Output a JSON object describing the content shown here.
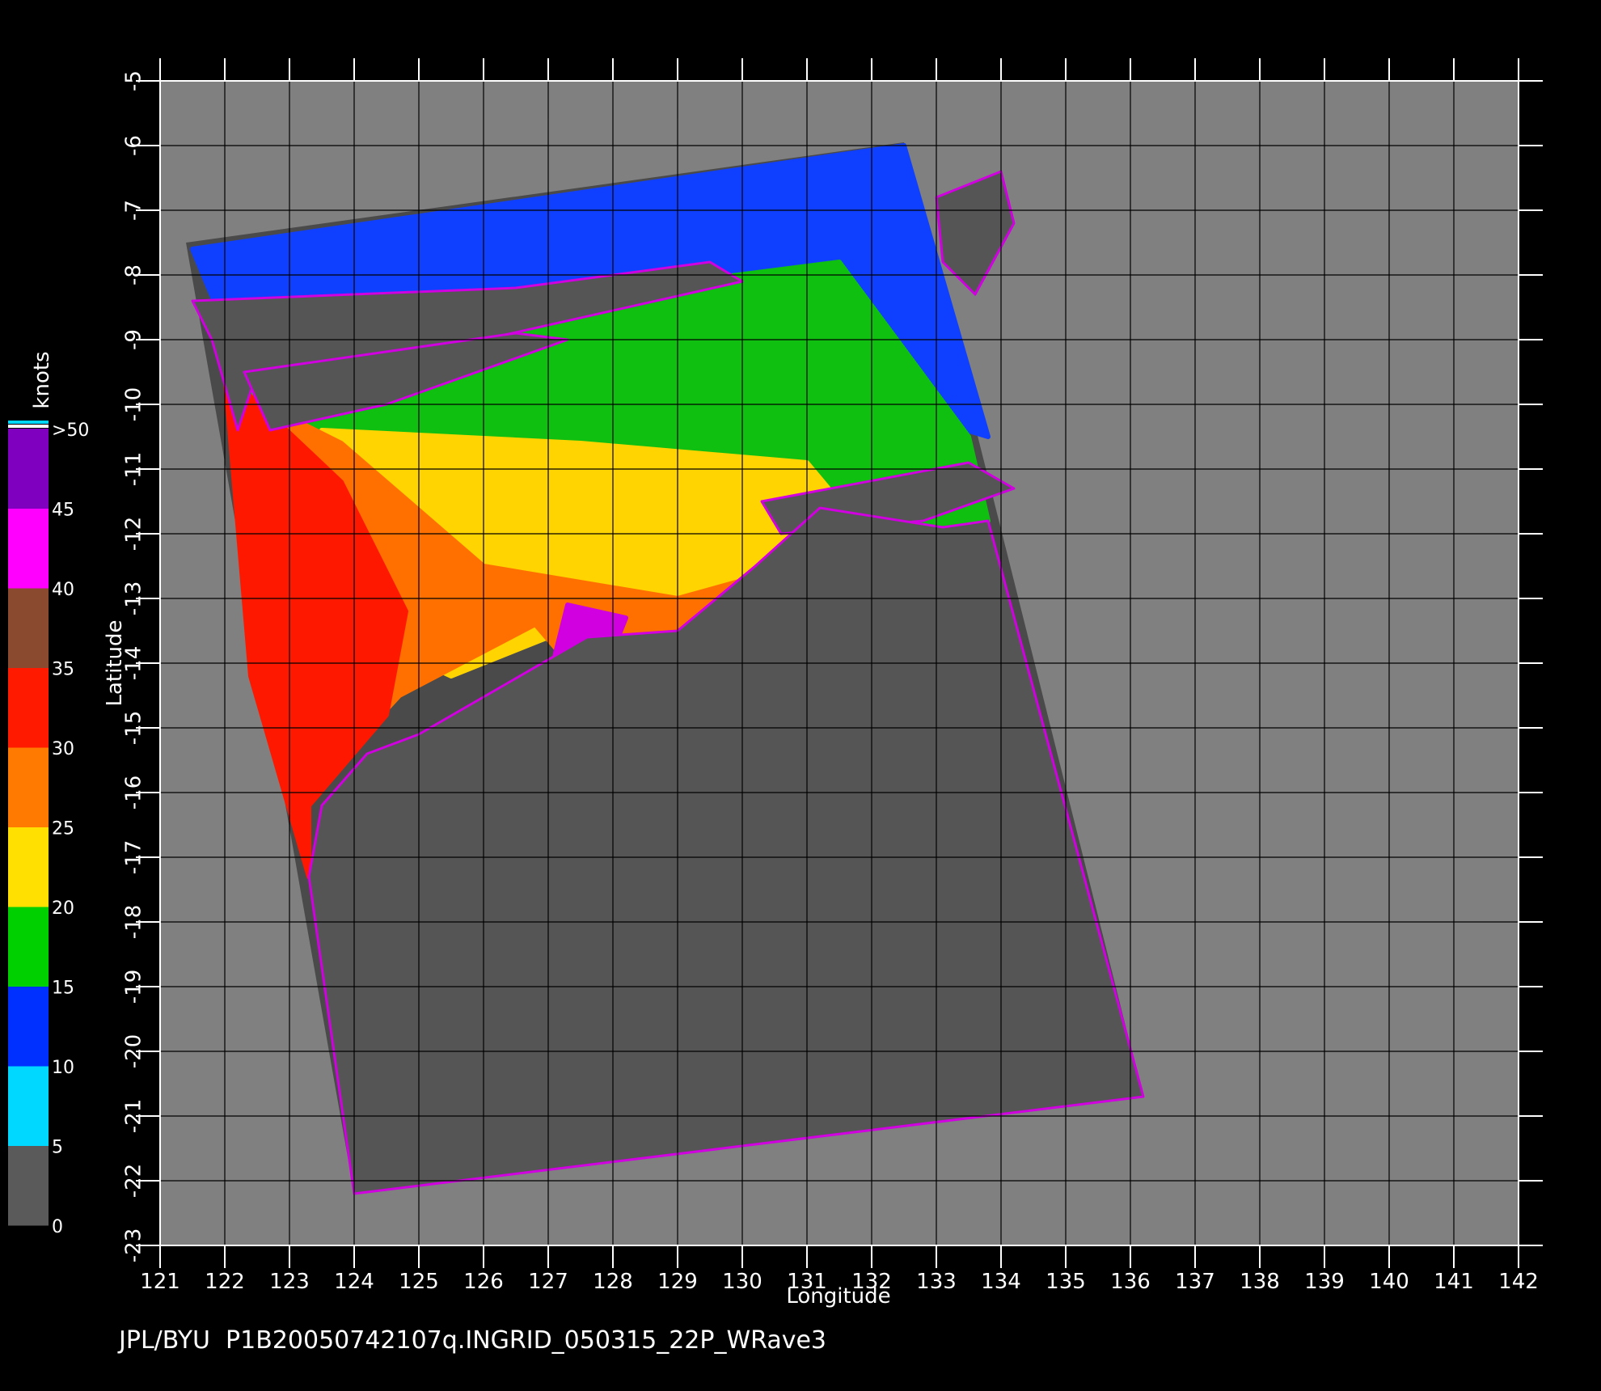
{
  "chart_data": {
    "type": "heatmap",
    "xlabel": "Longitude",
    "ylabel": "Latitude",
    "x_ticks": [
      "121",
      "122",
      "123",
      "124",
      "125",
      "126",
      "127",
      "128",
      "129",
      "130",
      "131",
      "132",
      "133",
      "134",
      "135",
      "136",
      "137",
      "138",
      "139",
      "140",
      "141",
      "142"
    ],
    "y_ticks": [
      "-5",
      "-6",
      "-7",
      "-8",
      "-9",
      "-10",
      "-11",
      "-12",
      "-13",
      "-14",
      "-15",
      "-16",
      "-17",
      "-18",
      "-19",
      "-20",
      "-21",
      "-22",
      "-23"
    ],
    "xlim": [
      121,
      142.3
    ],
    "ylim": [
      -23,
      -5
    ],
    "grid": true,
    "colorbar": {
      "unit_label": "knots",
      "tick_labels": [
        "0",
        "5",
        "10",
        "15",
        "20",
        "25",
        "30",
        "35",
        "40",
        "45",
        ">50"
      ],
      "bands": [
        {
          "from": 0,
          "to": 5,
          "color": "#5a5a5a"
        },
        {
          "from": 5,
          "to": 10,
          "color": "#00d8ff"
        },
        {
          "from": 10,
          "to": 15,
          "color": "#0030ff"
        },
        {
          "from": 15,
          "to": 20,
          "color": "#00d000"
        },
        {
          "from": 20,
          "to": 25,
          "color": "#ffe000"
        },
        {
          "from": 25,
          "to": 30,
          "color": "#ff7a00"
        },
        {
          "from": 30,
          "to": 35,
          "color": "#ff1a00"
        },
        {
          "from": 35,
          "to": 40,
          "color": "#8a4a30"
        },
        {
          "from": 40,
          "to": 45,
          "color": "#ff00ff"
        },
        {
          "from": 45,
          "to": 50,
          "color": "#8000c0"
        }
      ]
    },
    "swath_corners_lonlat": [
      [
        121.4,
        -7.5
      ],
      [
        132.5,
        -5.95
      ],
      [
        136.2,
        -20.7
      ],
      [
        124.0,
        -22.2
      ]
    ],
    "wind_speed_regions": [
      {
        "level": "blue 10-15 kt",
        "color": "#1040ff",
        "poly": [
          [
            121.5,
            -7.6
          ],
          [
            132.5,
            -6.0
          ],
          [
            133.8,
            -10.5
          ],
          [
            131.5,
            -9.8
          ],
          [
            126,
            -8.6
          ],
          [
            122,
            -8.8
          ]
        ]
      },
      {
        "level": "green 15-20 kt",
        "color": "#10c010",
        "poly": [
          [
            122,
            -8.8
          ],
          [
            126,
            -8.5
          ],
          [
            131.5,
            -7.8
          ],
          [
            133.5,
            -10.5
          ],
          [
            133.8,
            -11.8
          ],
          [
            131,
            -12.3
          ],
          [
            127.5,
            -10.8
          ],
          [
            124,
            -10.8
          ],
          [
            122.2,
            -10.2
          ]
        ]
      },
      {
        "level": "yellow 20-25 kt",
        "color": "#ffd400",
        "poly": [
          [
            123.5,
            -10.4
          ],
          [
            127.5,
            -10.6
          ],
          [
            131,
            -10.9
          ],
          [
            131.5,
            -11.5
          ],
          [
            130,
            -13.8
          ],
          [
            128,
            -13.2
          ],
          [
            125.5,
            -14.2
          ],
          [
            124,
            -13.5
          ],
          [
            123.2,
            -11.5
          ]
        ]
      },
      {
        "level": "orange 25-30 kt",
        "color": "#ff7000",
        "poly": [
          [
            122.2,
            -9.8
          ],
          [
            123.8,
            -10.6
          ],
          [
            126,
            -12.5
          ],
          [
            129,
            -13
          ],
          [
            130.8,
            -12.5
          ],
          [
            129.7,
            -14.7
          ],
          [
            128,
            -14.8
          ],
          [
            126.8,
            -13.4
          ],
          [
            124.7,
            -14.5
          ],
          [
            123.5,
            -15.8
          ],
          [
            122.8,
            -14
          ]
        ]
      },
      {
        "level": "red 30-35 kt",
        "color": "#ff1800",
        "poly": [
          [
            122,
            -9.5
          ],
          [
            123.8,
            -11.2
          ],
          [
            124.8,
            -13.2
          ],
          [
            124.5,
            -14.8
          ],
          [
            123.3,
            -16.2
          ],
          [
            123.3,
            -17.3
          ],
          [
            122.4,
            -14.2
          ]
        ]
      },
      {
        "level": "magenta >40 kt",
        "color": "#d000e0",
        "poly": [
          [
            127.3,
            -13.1
          ],
          [
            128.2,
            -13.3
          ],
          [
            127.8,
            -14.3
          ],
          [
            127.1,
            -13.9
          ]
        ]
      }
    ],
    "land_masses": [
      {
        "name": "",
        "poly": [
          [
            121.5,
            -8.4
          ],
          [
            126.5,
            -8.2
          ],
          [
            129.5,
            -7.8
          ],
          [
            130,
            -8.1
          ],
          [
            126,
            -9.0
          ],
          [
            122.5,
            -9.5
          ],
          [
            122.2,
            -10.4
          ],
          [
            121.8,
            -9.0
          ]
        ]
      },
      {
        "name": "",
        "poly": [
          [
            122.3,
            -9.5
          ],
          [
            126.5,
            -8.9
          ],
          [
            127.3,
            -9.0
          ],
          [
            124.5,
            -10.0
          ],
          [
            122.7,
            -10.4
          ]
        ]
      },
      {
        "name": "",
        "poly": [
          [
            133,
            -6.8
          ],
          [
            134.0,
            -6.4
          ],
          [
            134.2,
            -7.2
          ],
          [
            133.6,
            -8.3
          ],
          [
            133.1,
            -7.8
          ]
        ]
      },
      {
        "name": "",
        "poly": [
          [
            130.3,
            -11.5
          ],
          [
            133.5,
            -10.9
          ],
          [
            134.2,
            -11.3
          ],
          [
            132.8,
            -11.8
          ],
          [
            130.6,
            -12.0
          ]
        ]
      },
      {
        "name": "",
        "poly": [
          [
            125.0,
            -15.1
          ],
          [
            127.6,
            -13.6
          ],
          [
            129.0,
            -13.5
          ],
          [
            130.2,
            -12.5
          ],
          [
            131.2,
            -11.6
          ],
          [
            133.1,
            -11.9
          ],
          [
            133.8,
            -11.8
          ],
          [
            136.2,
            -20.7
          ],
          [
            124.0,
            -22.2
          ],
          [
            123.3,
            -17.3
          ],
          [
            123.5,
            -16.2
          ],
          [
            124.2,
            -15.4
          ]
        ]
      }
    ],
    "footer_text": "JPL/BYU  P1B20050742107q.INGRID_050315_22P_WRave3"
  }
}
